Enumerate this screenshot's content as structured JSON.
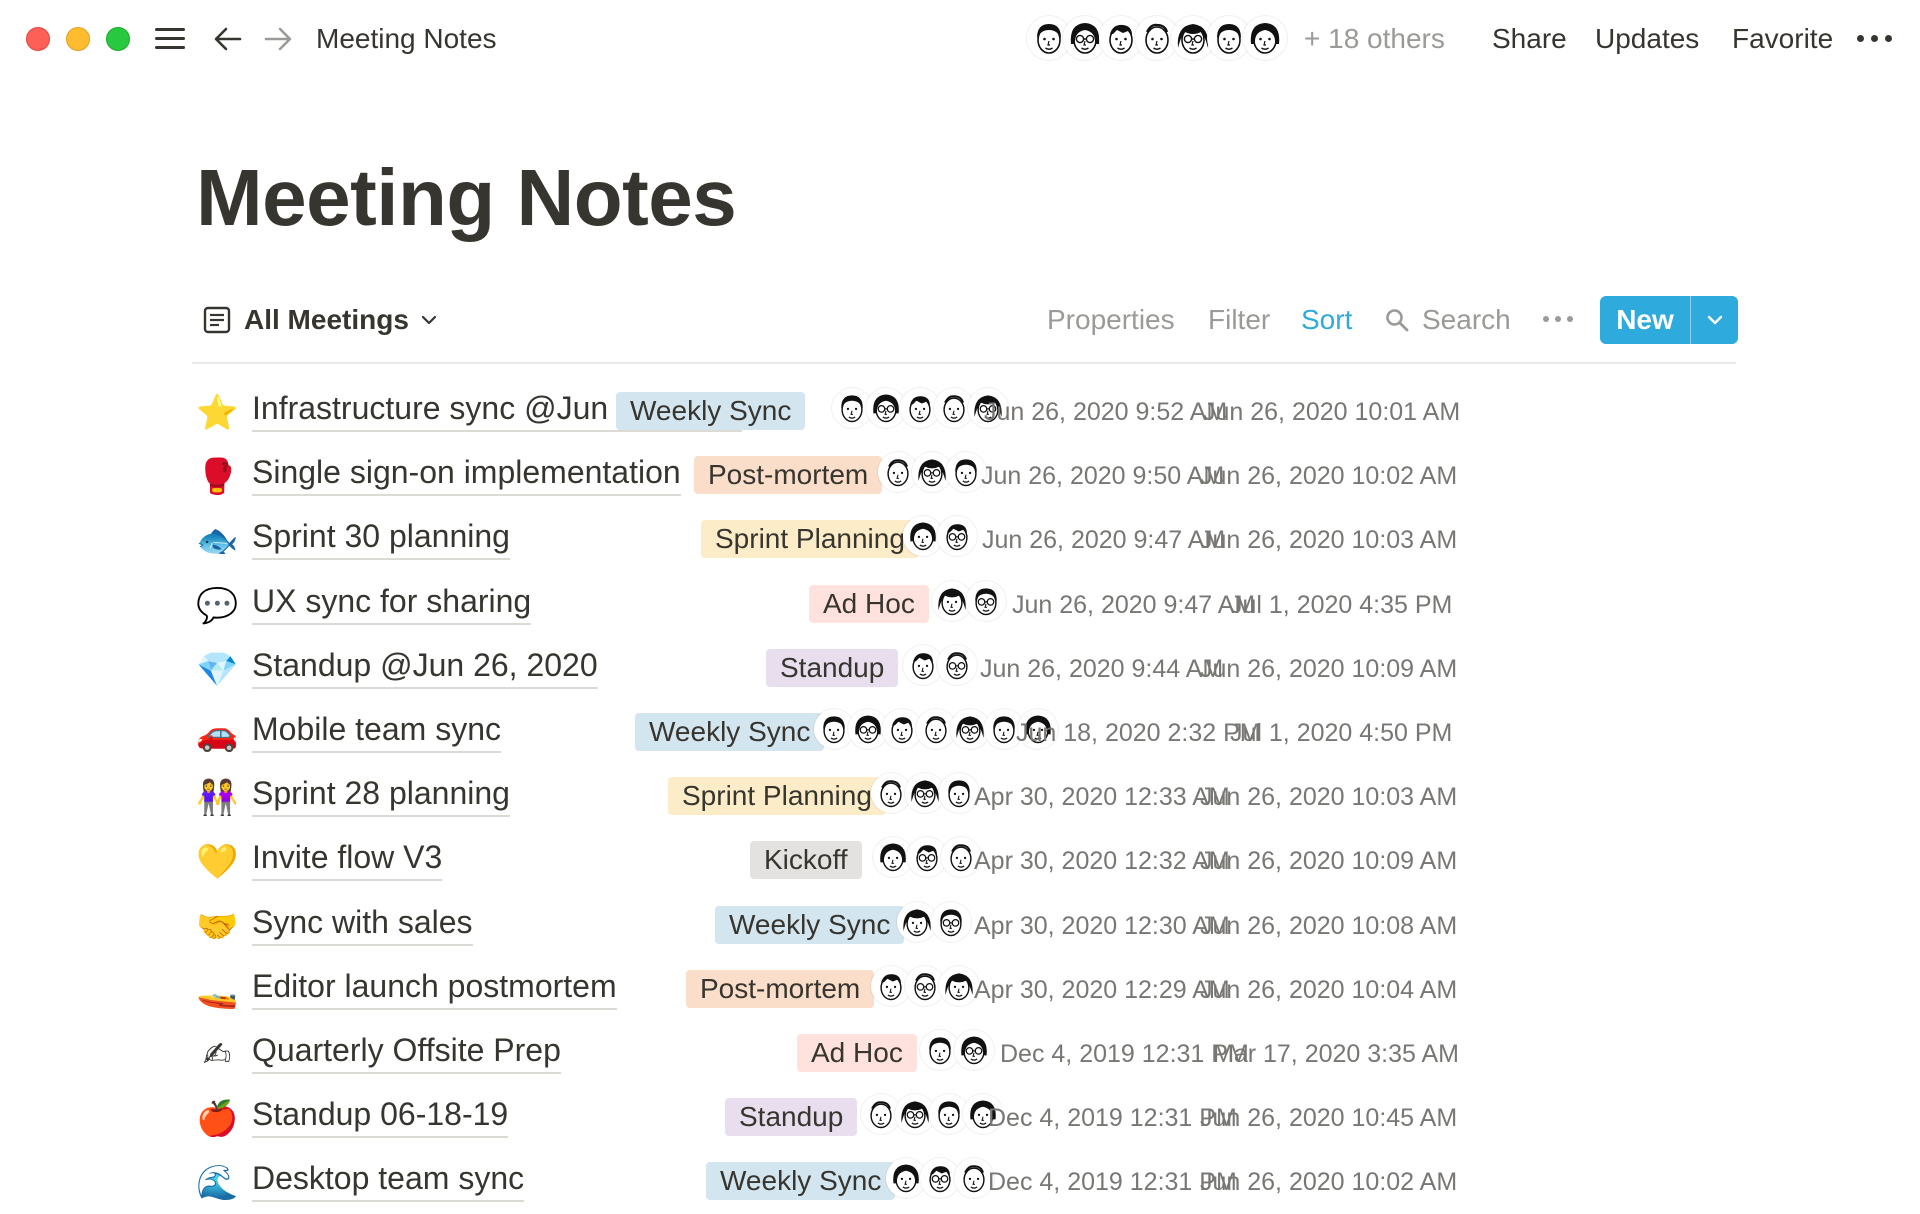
{
  "window": {
    "breadcrumb": "Meeting Notes",
    "collaborators_more": "+ 18 others",
    "actions": {
      "share": "Share",
      "updates": "Updates",
      "favorite": "Favorite"
    }
  },
  "page": {
    "title": "Meeting Notes"
  },
  "toolbar": {
    "view_label": "All Meetings",
    "properties": "Properties",
    "filter": "Filter",
    "sort": "Sort",
    "search": "Search",
    "new_label": "New"
  },
  "tag_colors": {
    "Weekly Sync": "#d3e5ef",
    "Post-mortem": "#fadec9",
    "Sprint Planning": "#fdecc8",
    "Ad Hoc": "#ffe2dd",
    "Standup": "#e8deee",
    "Kickoff": "#e3e2e0"
  },
  "rows": [
    {
      "emoji": "⭐",
      "title": "Infrastructure sync @Jun 26, 2020",
      "tag": "Weekly Sync",
      "attendees": 5,
      "created": "Jun 26, 2020 9:52 AM",
      "edited": "Jun 26, 2020 10:01 AM"
    },
    {
      "emoji": "🥊",
      "title": "Single sign-on implementation",
      "tag": "Post-mortem",
      "attendees": 3,
      "created": "Jun 26, 2020 9:50 AM",
      "edited": "Jun 26, 2020 10:02 AM"
    },
    {
      "emoji": "🐟",
      "title": "Sprint 30 planning",
      "tag": "Sprint Planning",
      "attendees": 2,
      "created": "Jun 26, 2020 9:47 AM",
      "edited": "Jun 26, 2020 10:03 AM"
    },
    {
      "emoji": "💬",
      "title": "UX sync for sharing",
      "tag": "Ad Hoc",
      "attendees": 2,
      "created": "Jun 26, 2020 9:47 AM",
      "edited": "Jul 1, 2020 4:35 PM"
    },
    {
      "emoji": "💎",
      "title": "Standup @Jun 26, 2020",
      "tag": "Standup",
      "attendees": 2,
      "created": "Jun 26, 2020 9:44 AM",
      "edited": "Jun 26, 2020 10:09 AM"
    },
    {
      "emoji": "🚗",
      "title": "Mobile team sync",
      "tag": "Weekly Sync",
      "attendees": 7,
      "created": "Jun 18, 2020 2:32 PM",
      "edited": "Jul 1, 2020 4:50 PM"
    },
    {
      "emoji": "👭",
      "title": "Sprint 28 planning",
      "tag": "Sprint Planning",
      "attendees": 3,
      "created": "Apr 30, 2020 12:33 AM",
      "edited": "Jun 26, 2020 10:03 AM"
    },
    {
      "emoji": "💛",
      "title": "Invite flow V3",
      "tag": "Kickoff",
      "attendees": 3,
      "created": "Apr 30, 2020 12:32 AM",
      "edited": "Jun 26, 2020 10:09 AM"
    },
    {
      "emoji": "🤝",
      "title": "Sync with sales",
      "tag": "Weekly Sync",
      "attendees": 2,
      "created": "Apr 30, 2020 12:30 AM",
      "edited": "Jun 26, 2020 10:08 AM"
    },
    {
      "emoji": "🚤",
      "title": "Editor launch postmortem",
      "tag": "Post-mortem",
      "attendees": 3,
      "created": "Apr 30, 2020 12:29 AM",
      "edited": "Jun 26, 2020 10:04 AM"
    },
    {
      "emoji": "✍",
      "title": "Quarterly Offsite Prep",
      "tag": "Ad Hoc",
      "attendees": 2,
      "created": "Dec 4, 2019 12:31 PM",
      "edited": "Mar 17, 2020 3:35 AM"
    },
    {
      "emoji": "🍎",
      "title": "Standup 06-18-19",
      "tag": "Standup",
      "attendees": 4,
      "created": "Dec 4, 2019 12:31 PM",
      "edited": "Jun 26, 2020 10:45 AM"
    },
    {
      "emoji": "🌊",
      "title": "Desktop team sync",
      "tag": "Weekly Sync",
      "attendees": 3,
      "created": "Dec 4, 2019 12:31 PM",
      "edited": "Jun 26, 2020 10:02 AM"
    }
  ]
}
